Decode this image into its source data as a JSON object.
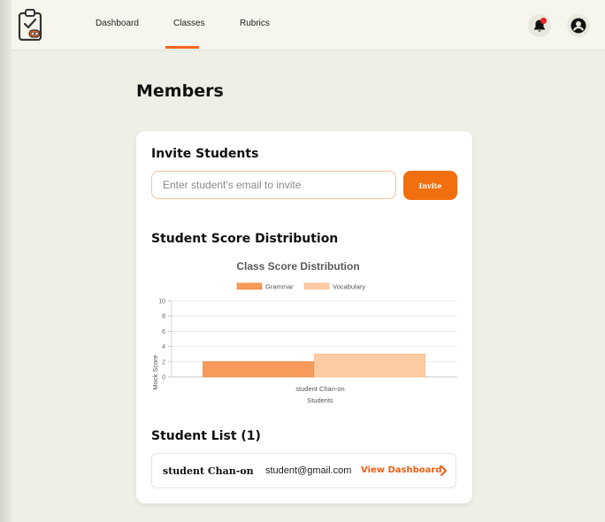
{
  "nav": {
    "items": [
      {
        "label": "Dashboard"
      },
      {
        "label": "Classes"
      },
      {
        "label": "Rubrics"
      }
    ],
    "active": "Classes"
  },
  "page": {
    "title": "Members"
  },
  "invite": {
    "title": "Invite Students",
    "placeholder": "Enter student's email to invite",
    "value": "",
    "button_label": "Invite"
  },
  "score_section": {
    "title": "Student Score Distribution"
  },
  "chart_data": {
    "type": "bar",
    "title": "Class Score Distribution",
    "categories": [
      "student Chan-on"
    ],
    "series": [
      {
        "name": "Grammar",
        "values": [
          2
        ],
        "color": "#f79a5a"
      },
      {
        "name": "Vocabulary",
        "values": [
          3
        ],
        "color": "#fdcba3"
      }
    ],
    "xlabel": "Students",
    "ylabel": "Mock Score",
    "ylim": [
      0,
      10
    ],
    "yticks": [
      "0",
      "2",
      "4",
      "6",
      "8",
      "10"
    ],
    "legend": "top-center",
    "grid": true
  },
  "student_list": {
    "title": "Student List (1)",
    "students": [
      {
        "name": "student Chan-on",
        "email": "student@gmail.com",
        "action": "View Dashboard"
      }
    ]
  },
  "colors": {
    "accent": "#f26522",
    "notification_dot": "#e8201f"
  },
  "icons": [
    "clipboard-logo-icon",
    "bell-icon",
    "user-circle-icon",
    "chevron-right-icon"
  ]
}
